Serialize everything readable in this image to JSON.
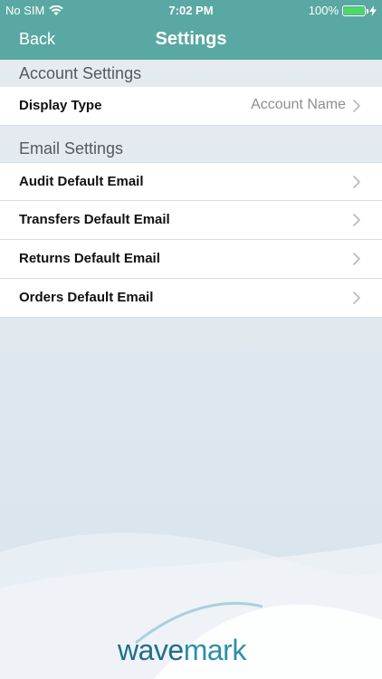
{
  "status_bar": {
    "carrier": "No SIM",
    "time": "7:02 PM",
    "battery": "100%"
  },
  "nav": {
    "back_label": "Back",
    "title": "Settings"
  },
  "sections": {
    "account": {
      "title": "Account Settings",
      "rows": [
        {
          "label": "Display Type",
          "value": "Account Name"
        }
      ]
    },
    "email": {
      "title": "Email Settings",
      "rows": [
        {
          "label": "Audit Default Email"
        },
        {
          "label": "Transfers Default Email"
        },
        {
          "label": "Returns Default Email"
        },
        {
          "label": "Orders Default Email"
        }
      ]
    }
  },
  "logo": {
    "part1": "wave",
    "part2": "mark"
  },
  "colors": {
    "header": "#5aa8a3",
    "battery": "#4cd964",
    "logo": "#1f6f8b"
  },
  "icons": [
    "wifi-icon",
    "battery-icon",
    "charging-icon",
    "chevron-right-icon"
  ]
}
